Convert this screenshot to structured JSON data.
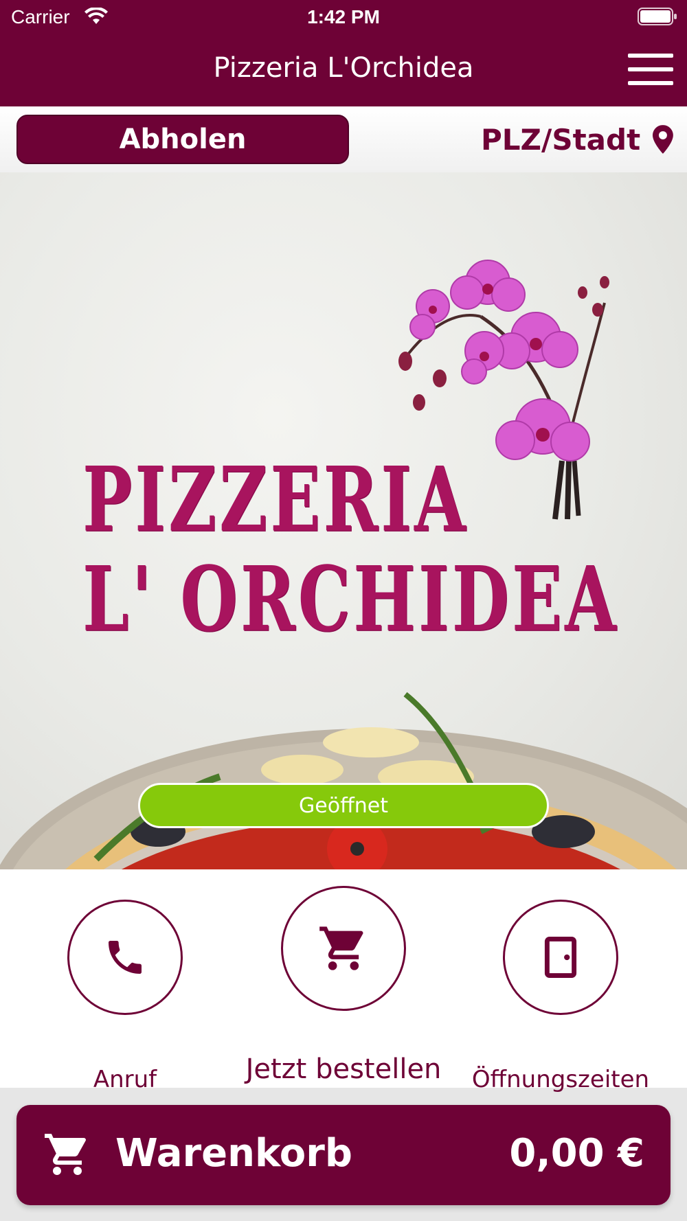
{
  "status_bar": {
    "carrier": "Carrier",
    "time": "1:42 PM",
    "icons": [
      "wifi-icon",
      "battery-icon"
    ]
  },
  "header": {
    "title": "Pizzeria L'Orchidea",
    "menu_icon": "menu-icon"
  },
  "subbar": {
    "pickup_label": "Abholen",
    "location_placeholder": "PLZ/Stadt",
    "location_icon": "pin-icon"
  },
  "hero": {
    "logo_line_1": "PIZZERIA",
    "logo_line_2": "L' ORCHIDEA",
    "status_badge": "Geöffnet",
    "status_color": "#86c90b",
    "logo_color": "#a8145e"
  },
  "actions": [
    {
      "label": "Anruf",
      "icon": "phone-icon"
    },
    {
      "label": "Jetzt bestellen",
      "icon": "cart-icon"
    },
    {
      "label": "Öffnungszeiten",
      "icon": "door-icon"
    }
  ],
  "cart": {
    "label": "Warenkorb",
    "total": "0,00 €",
    "icon": "cart-icon"
  },
  "colors": {
    "brand": "#6e0236",
    "background": "#e6e6e6"
  }
}
